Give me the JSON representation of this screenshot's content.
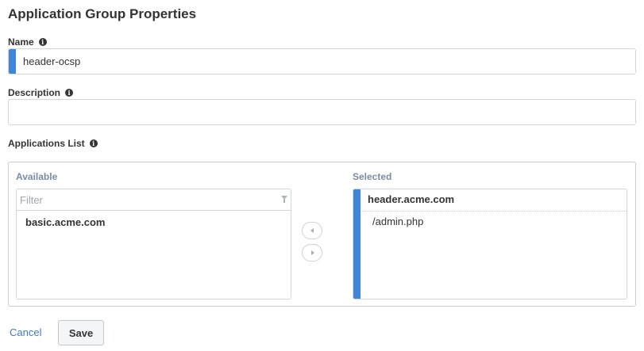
{
  "page": {
    "title": "Application Group Properties"
  },
  "name_field": {
    "label": "Name",
    "value": "header-ocsp",
    "info_icon": "info-icon"
  },
  "description_field": {
    "label": "Description",
    "value": "",
    "info_icon": "info-icon"
  },
  "applications_list": {
    "label": "Applications List",
    "info_icon": "info-icon",
    "available": {
      "heading": "Available",
      "filter_placeholder": "Filter",
      "filter_icon": "filter-icon",
      "items": [
        "basic.acme.com"
      ]
    },
    "controls": {
      "move_left_icon": "chevron-left-icon",
      "move_right_icon": "chevron-right-icon"
    },
    "selected": {
      "heading": "Selected",
      "groups": [
        {
          "name": "header.acme.com",
          "paths": [
            "/admin.php"
          ]
        }
      ]
    }
  },
  "actions": {
    "cancel_label": "Cancel",
    "save_label": "Save"
  },
  "colors": {
    "accent": "#3f86d9",
    "link": "#3f7cc4",
    "heading_muted": "#7a8ca3"
  }
}
